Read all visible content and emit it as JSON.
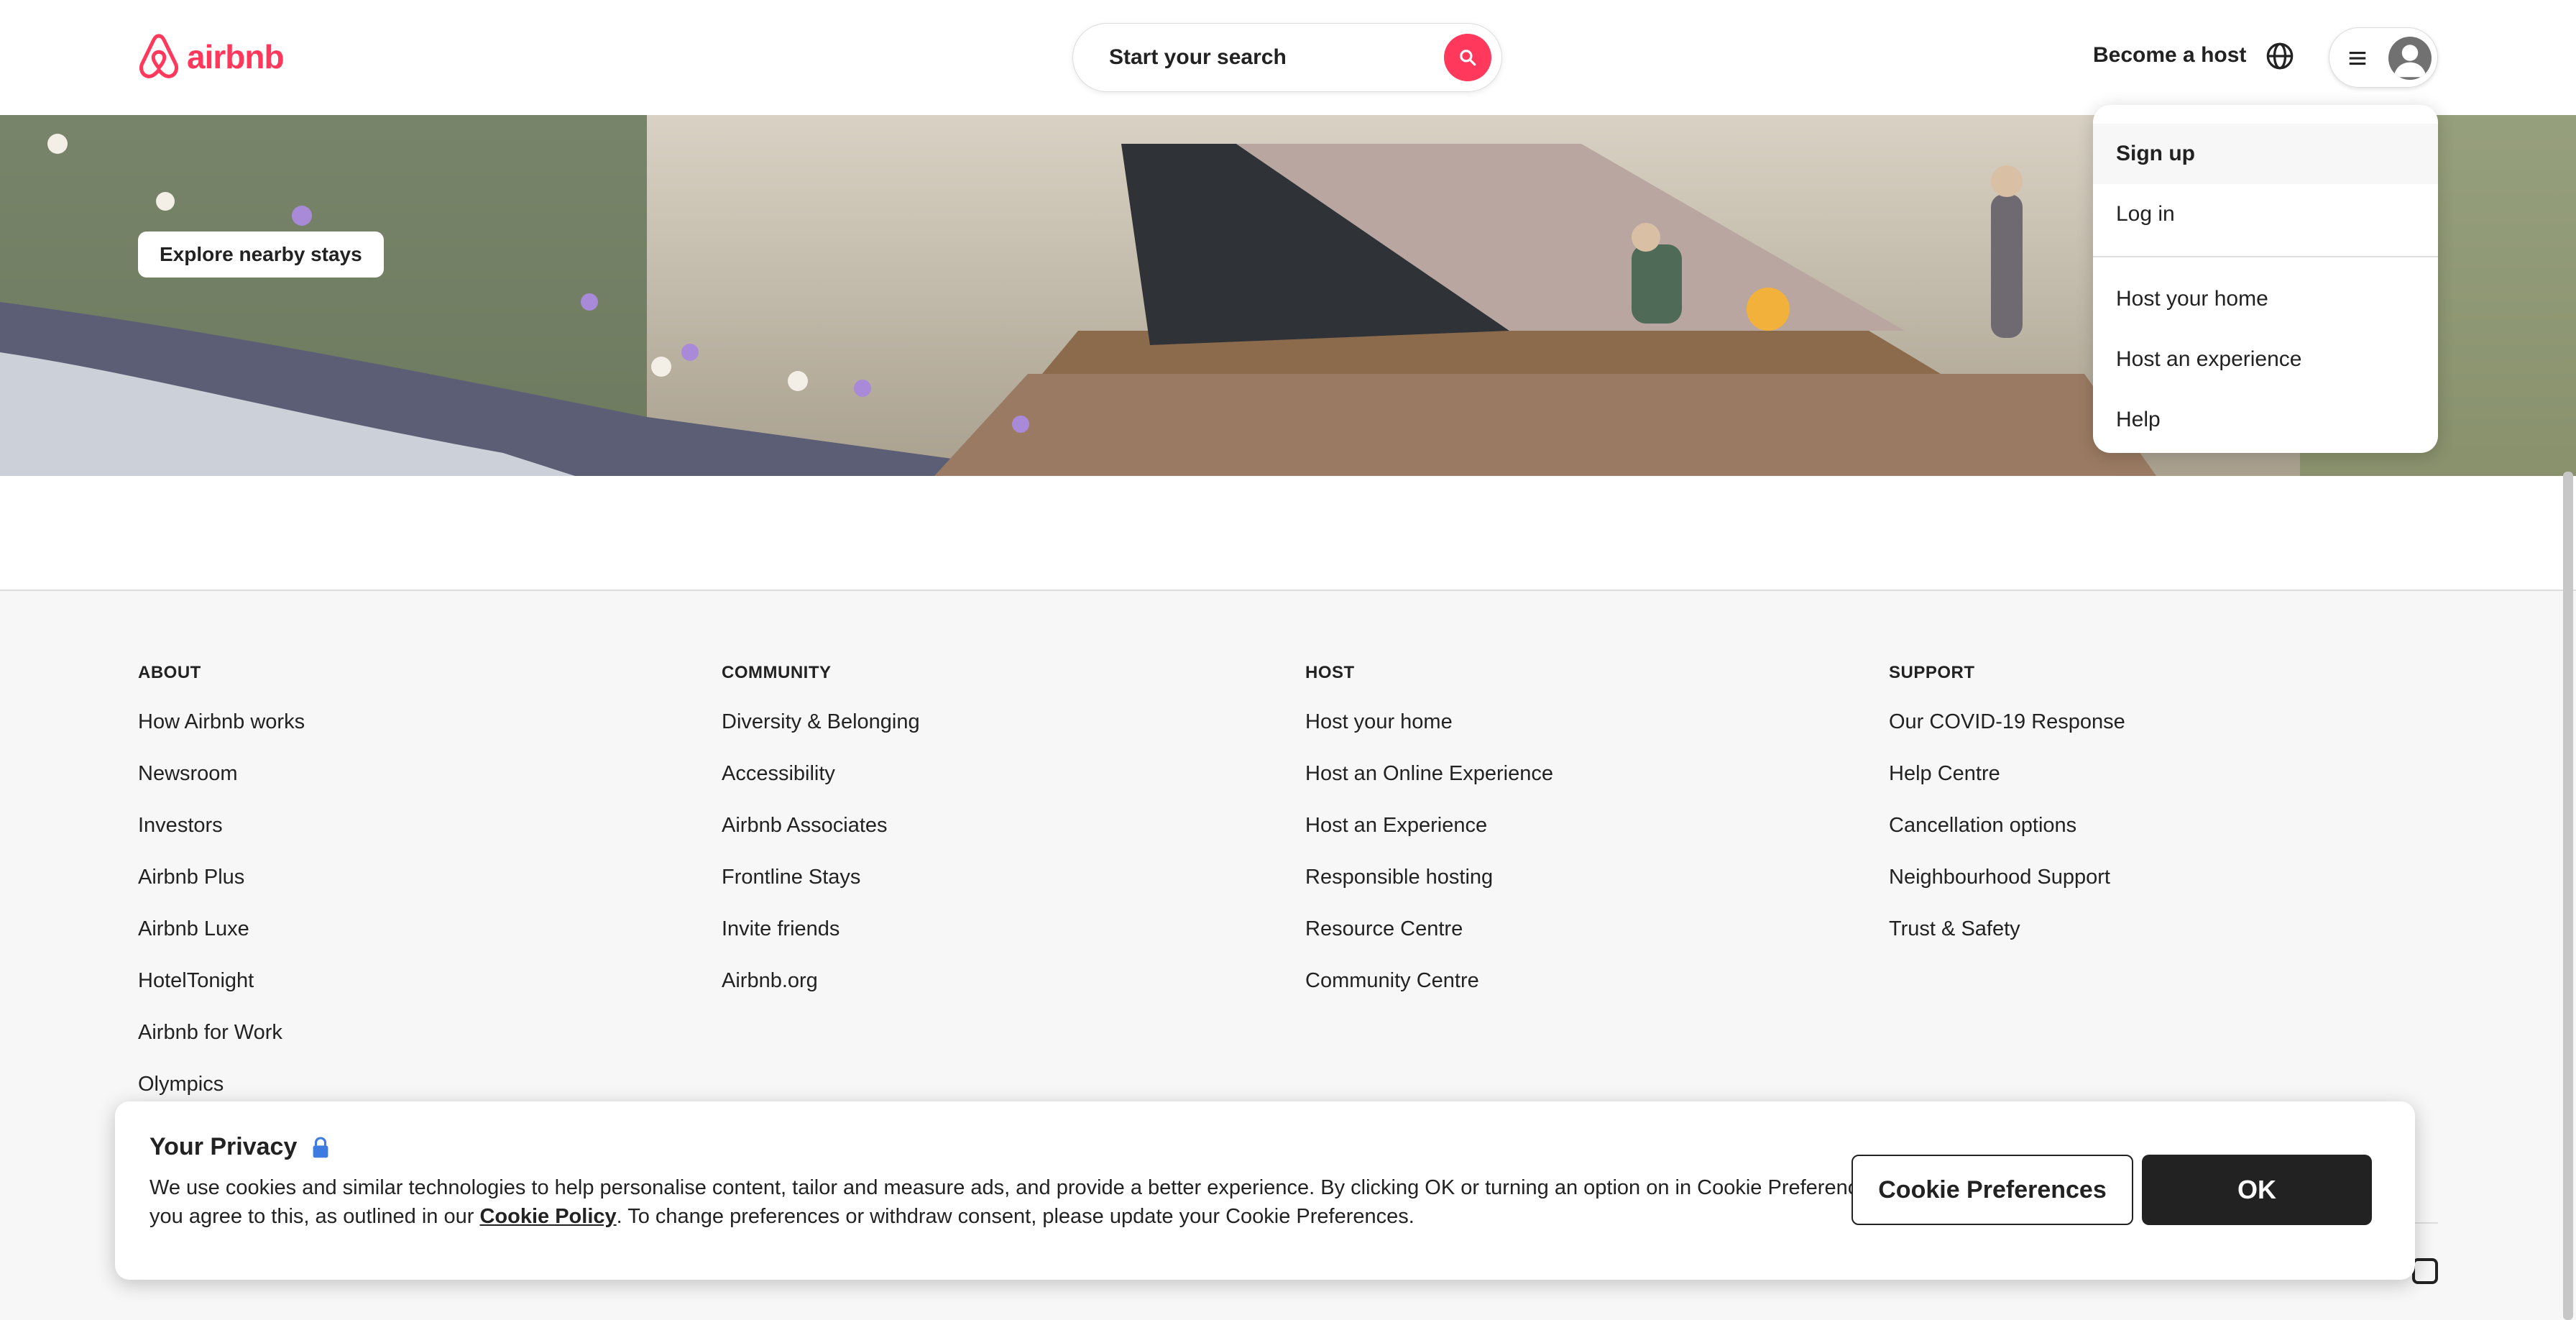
{
  "brand": {
    "name": "airbnb",
    "color": "#FF385C"
  },
  "header": {
    "search_label": "Start your search",
    "host_link": "Become a host"
  },
  "hero": {
    "explore_label": "Explore nearby stays"
  },
  "user_dropdown": {
    "items": [
      "Sign up",
      "Log in",
      "Host your home",
      "Host an experience",
      "Help"
    ]
  },
  "footer": {
    "columns": [
      {
        "title": "ABOUT",
        "links": [
          "How Airbnb works",
          "Newsroom",
          "Investors",
          "Airbnb Plus",
          "Airbnb Luxe",
          "HotelTonight",
          "Airbnb for Work",
          "Olympics"
        ]
      },
      {
        "title": "COMMUNITY",
        "links": [
          "Diversity & Belonging",
          "Accessibility",
          "Airbnb Associates",
          "Frontline Stays",
          "Invite friends",
          "Airbnb.org"
        ]
      },
      {
        "title": "HOST",
        "links": [
          "Host your home",
          "Host an Online Experience",
          "Host an Experience",
          "Responsible hosting",
          "Resource Centre",
          "Community Centre"
        ]
      },
      {
        "title": "SUPPORT",
        "links": [
          "Our COVID-19 Response",
          "Help Centre",
          "Cancellation options",
          "Neighbourhood Support",
          "Trust & Safety"
        ]
      }
    ]
  },
  "cookie_banner": {
    "title": "Your Privacy",
    "text_before": "We use cookies and similar technologies to help personalise content, tailor and measure ads, and provide a better experience. By clicking OK or turning an option on in Cookie Preferences, you agree to this, as outlined in our ",
    "link_text": "Cookie Policy",
    "text_after": ". To change preferences or withdraw consent, please update your Cookie Preferences.",
    "preferences_label": "Cookie Preferences",
    "ok_label": "OK"
  }
}
